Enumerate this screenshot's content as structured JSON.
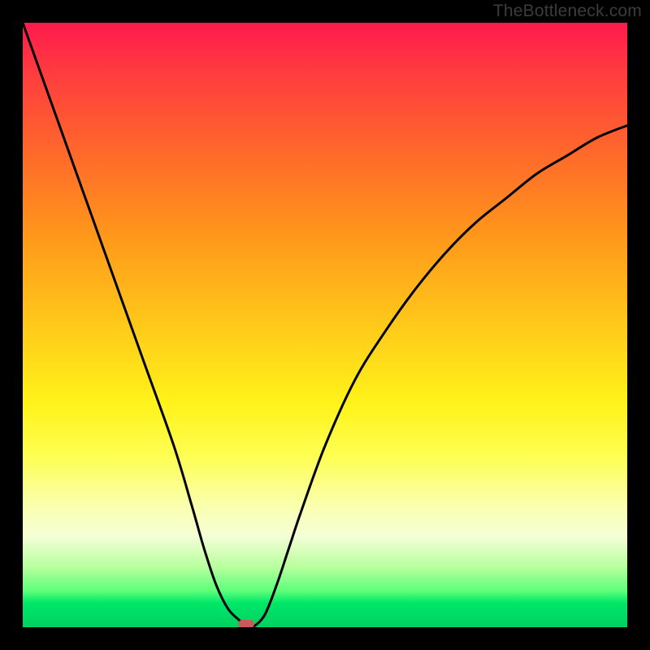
{
  "watermark": {
    "text": "TheBottleneck.com"
  },
  "chart_data": {
    "type": "line",
    "title": "",
    "xlabel": "",
    "ylabel": "",
    "xlim": [
      0,
      100
    ],
    "ylim": [
      0,
      100
    ],
    "grid": false,
    "series": [
      {
        "name": "bottleneck-curve",
        "x": [
          0,
          5,
          10,
          15,
          20,
          25,
          28,
          30,
          32,
          34,
          36,
          37,
          38,
          40,
          42,
          44,
          46,
          50,
          55,
          60,
          65,
          70,
          75,
          80,
          85,
          90,
          95,
          100
        ],
        "values": [
          100,
          86,
          72,
          58,
          44,
          30,
          20,
          13,
          7,
          3,
          1,
          0,
          0,
          2,
          7,
          13,
          19,
          30,
          41,
          49,
          56,
          62,
          67,
          71,
          75,
          78,
          81,
          83
        ]
      }
    ],
    "annotations": [
      {
        "name": "min-marker",
        "x": 37,
        "y": 0
      }
    ],
    "background_gradient_stops": [
      {
        "pct": 0,
        "color": "#ff1a4d"
      },
      {
        "pct": 50,
        "color": "#ffc91a"
      },
      {
        "pct": 80,
        "color": "#faffb0"
      },
      {
        "pct": 100,
        "color": "#00d060"
      }
    ]
  }
}
